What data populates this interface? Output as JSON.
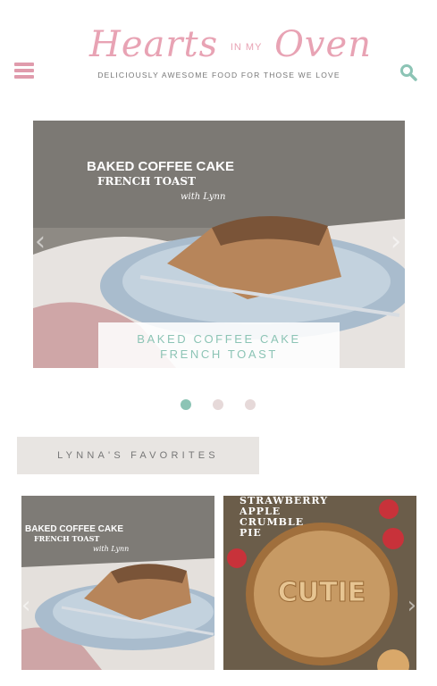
{
  "header": {
    "logo_word_1": "Hearts",
    "logo_word_small": "IN MY",
    "logo_word_2": "Oven",
    "tagline": "DELICIOUSLY AWESOME FOOD FOR THOSE WE LOVE"
  },
  "hero": {
    "image_title_line1": "BAKED COFFEE CAKE",
    "image_title_line2": "FRENCH TOAST",
    "image_signature": "with Lynn",
    "caption_line1": "BAKED COFFEE CAKE",
    "caption_line2": "FRENCH TOAST",
    "active_slide": 1,
    "slide_count": 3
  },
  "favorites": {
    "heading": "LYNNA'S FAVORITES",
    "cards": [
      {
        "title_line1": "BAKED COFFEE CAKE",
        "title_line2": "FRENCH TOAST",
        "signature": "with Lynn"
      },
      {
        "title_lines": [
          "STRAWBERRY",
          "APPLE",
          "CRUMBLE",
          "PIE"
        ],
        "pie_text": "CUTIE"
      }
    ]
  },
  "colors": {
    "brand_pink": "#e8a3b4",
    "accent_teal": "#8cc4b5",
    "dot_inactive": "#e6d9d9",
    "favorites_bg": "#e8e5e2"
  },
  "icons": [
    "menu-icon",
    "search-icon",
    "chevron-left-icon",
    "chevron-right-icon"
  ]
}
